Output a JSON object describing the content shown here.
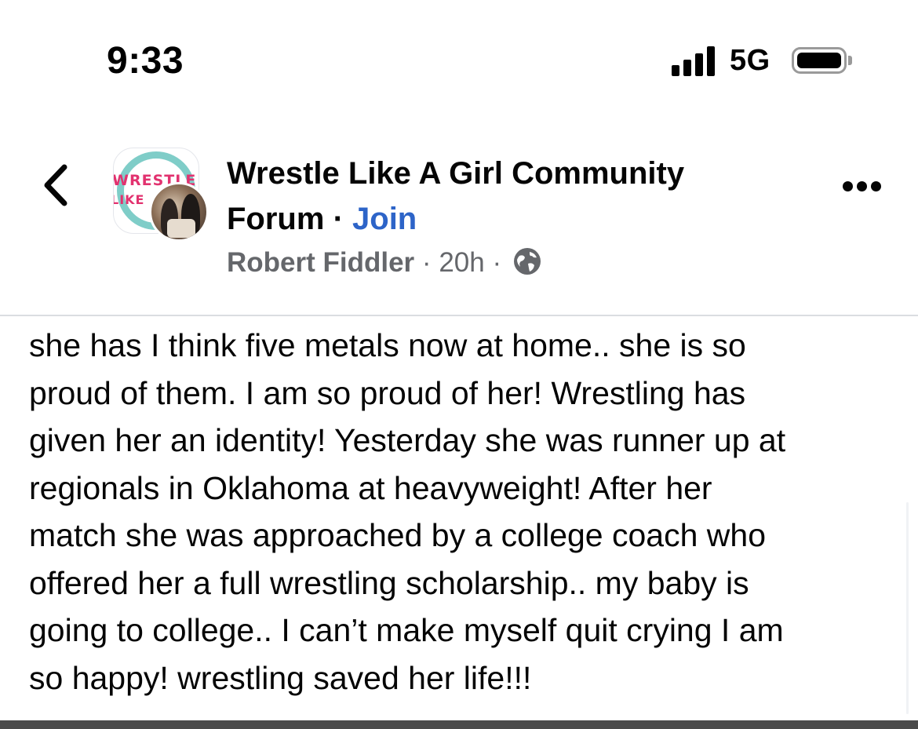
{
  "status_bar": {
    "time": "9:33",
    "network": "5G",
    "battery_level": 1.0
  },
  "header": {
    "back_icon": "chevron-left-icon",
    "group_name": "Wrestle Like A Girl Community Forum",
    "separator": "·",
    "join_label": "Join",
    "author": "Robert Fiddler",
    "timestamp": "20h",
    "privacy_icon": "globe-icon",
    "more_icon": "more-horizontal-icon",
    "logo_text_top": "WRESTLE",
    "logo_text_mid": "LIKE"
  },
  "post": {
    "lines": [
      "she has I think five metals now at home.. she is so",
      "proud of them. I am so proud of her! Wrestling has",
      "given her an identity! Yesterday she was runner up at",
      "regionals in Oklahoma at heavyweight! After her",
      "match she was approached by a college coach who",
      "offered her a full wrestling scholarship.. my baby is",
      "going to college.. I can’t make myself quit crying I am",
      "so happy! wrestling saved her life!!!"
    ]
  },
  "colors": {
    "link": "#2d64c8",
    "meta_text": "#65676b",
    "logo_ring": "#7fcdc8",
    "logo_text": "#e2326f",
    "divider": "#dadde1"
  }
}
